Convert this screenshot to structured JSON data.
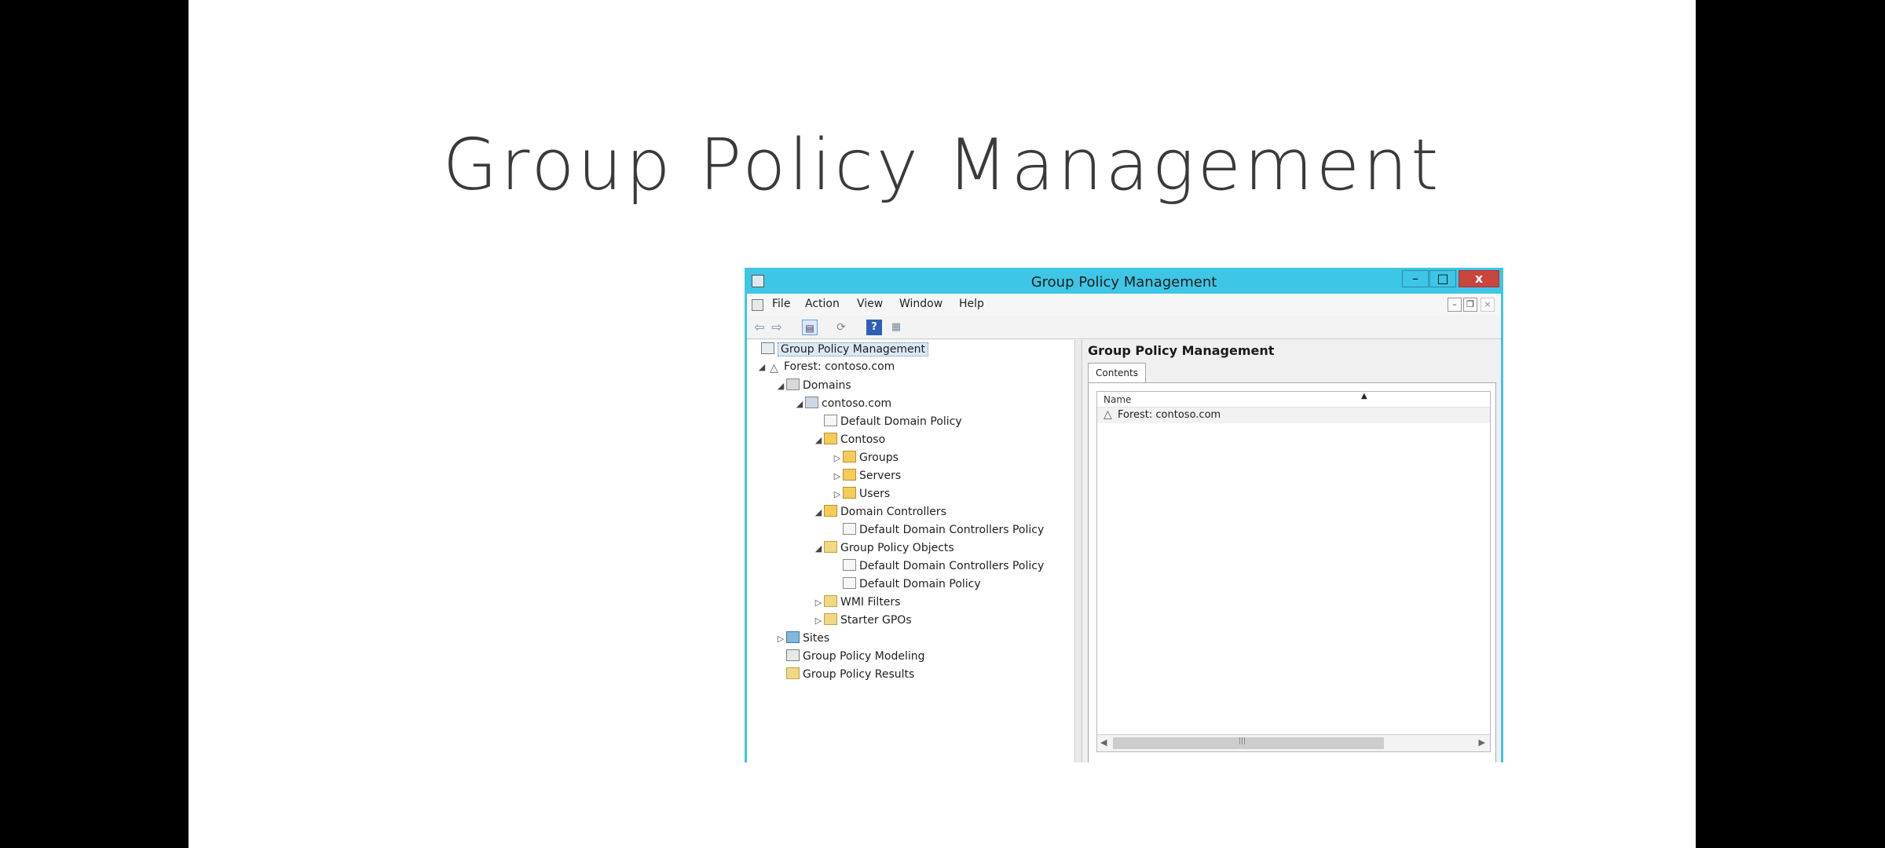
{
  "slide": {
    "title": "Group Policy Management"
  },
  "window": {
    "title": "Group Policy Management",
    "controls": {
      "minimize": "–",
      "maximize": "□",
      "close": "x"
    }
  },
  "menubar": {
    "items": [
      "File",
      "Action",
      "View",
      "Window",
      "Help"
    ]
  },
  "toolbar": {
    "icons": [
      "back-arrow-icon",
      "forward-arrow-icon",
      "console-tree-icon",
      "refresh-icon",
      "help-icon",
      "grid-view-icon"
    ]
  },
  "tree": {
    "items": [
      {
        "label": "Group Policy Management",
        "icon": "console-icon",
        "expander": "",
        "selected": true
      },
      {
        "label": "Forest: contoso.com",
        "icon": "forest-icon",
        "expander": "expanded"
      },
      {
        "label": "Domains",
        "icon": "domains-icon",
        "expander": "expanded"
      },
      {
        "label": "contoso.com",
        "icon": "domain-icon",
        "expander": "expanded"
      },
      {
        "label": "Default Domain Policy",
        "icon": "gpo-link-icon",
        "expander": ""
      },
      {
        "label": "Contoso",
        "icon": "ou-icon",
        "expander": "expanded"
      },
      {
        "label": "Groups",
        "icon": "ou-icon",
        "expander": "collapsed"
      },
      {
        "label": "Servers",
        "icon": "ou-icon",
        "expander": "collapsed"
      },
      {
        "label": "Users",
        "icon": "ou-icon",
        "expander": "collapsed"
      },
      {
        "label": "Domain Controllers",
        "icon": "ou-icon",
        "expander": "expanded"
      },
      {
        "label": "Default Domain Controllers Policy",
        "icon": "gpo-link-icon",
        "expander": ""
      },
      {
        "label": "Group Policy Objects",
        "icon": "folder-icon",
        "expander": "expanded"
      },
      {
        "label": "Default Domain Controllers Policy",
        "icon": "gpo-icon",
        "expander": ""
      },
      {
        "label": "Default Domain Policy",
        "icon": "gpo-icon",
        "expander": ""
      },
      {
        "label": "WMI Filters",
        "icon": "folder-icon",
        "expander": "collapsed"
      },
      {
        "label": "Starter GPOs",
        "icon": "folder-icon",
        "expander": "collapsed"
      },
      {
        "label": "Sites",
        "icon": "sites-icon",
        "expander": "collapsed"
      },
      {
        "label": "Group Policy Modeling",
        "icon": "modeling-icon",
        "expander": ""
      },
      {
        "label": "Group Policy Results",
        "icon": "results-icon",
        "expander": ""
      }
    ]
  },
  "content": {
    "title": "Group Policy Management",
    "tab": "Contents",
    "list": {
      "column": "Name",
      "rows": [
        "Forest: contoso.com"
      ]
    }
  }
}
